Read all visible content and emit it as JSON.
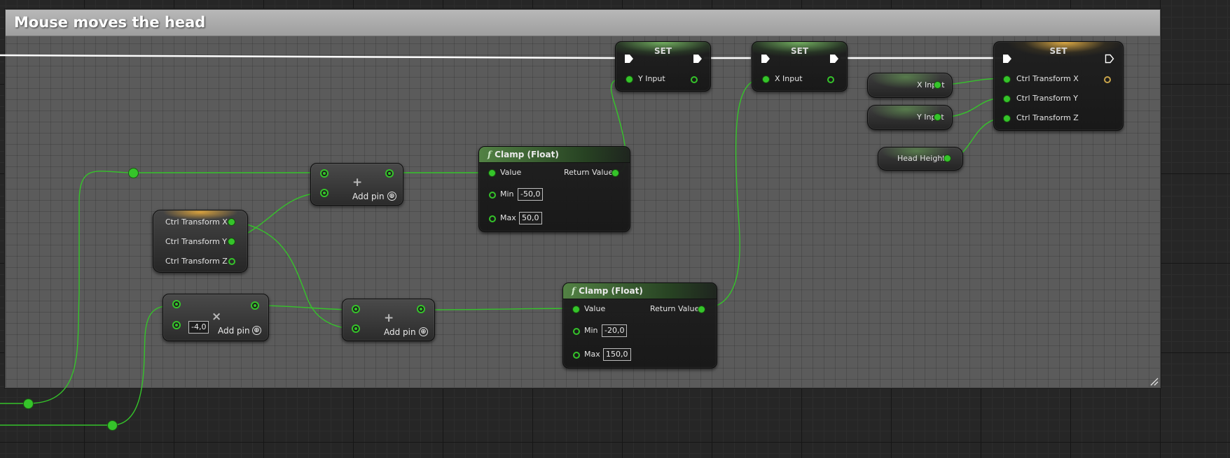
{
  "comment": {
    "title": "Mouse moves the head"
  },
  "set_nodes": [
    {
      "title": "SET",
      "input_label": "Y Input"
    },
    {
      "title": "SET",
      "input_label": "X Input"
    },
    {
      "title": "SET",
      "inputs": [
        "Ctrl Transform X",
        "Ctrl Transform Y",
        "Ctrl Transform Z"
      ]
    }
  ],
  "get_nodes": {
    "x_input": "X Input",
    "y_input": "Y Input",
    "head_height": "Head Height"
  },
  "break_node": {
    "outputs": [
      "Ctrl Transform X",
      "Ctrl Transform Y",
      "Ctrl Transform Z"
    ]
  },
  "add_nodes": [
    {
      "operator": "+",
      "add_pin_label": "Add pin",
      "add_pin_icon": "⊕"
    },
    {
      "operator": "+",
      "add_pin_label": "Add pin",
      "add_pin_icon": "⊕"
    }
  ],
  "multiply_node": {
    "operator": "×",
    "value": "-4,0",
    "add_pin_label": "Add pin",
    "add_pin_icon": "⊕"
  },
  "clamp_nodes": [
    {
      "title": "Clamp (Float)",
      "icon": "f",
      "value_label": "Value",
      "return_label": "Return Value",
      "min_label": "Min",
      "min_value": "-50,0",
      "max_label": "Max",
      "max_value": "50,0"
    },
    {
      "title": "Clamp (Float)",
      "icon": "f",
      "value_label": "Value",
      "return_label": "Return Value",
      "min_label": "Min",
      "min_value": "-20,0",
      "max_label": "Max",
      "max_value": "150,0"
    }
  ],
  "colors": {
    "exec_wire": "#ffffff",
    "float_wire": "#35c42a",
    "float_pin": "#35c42a",
    "struct_pin": "#c9a44a",
    "comment_header": "#a9a9a9"
  }
}
